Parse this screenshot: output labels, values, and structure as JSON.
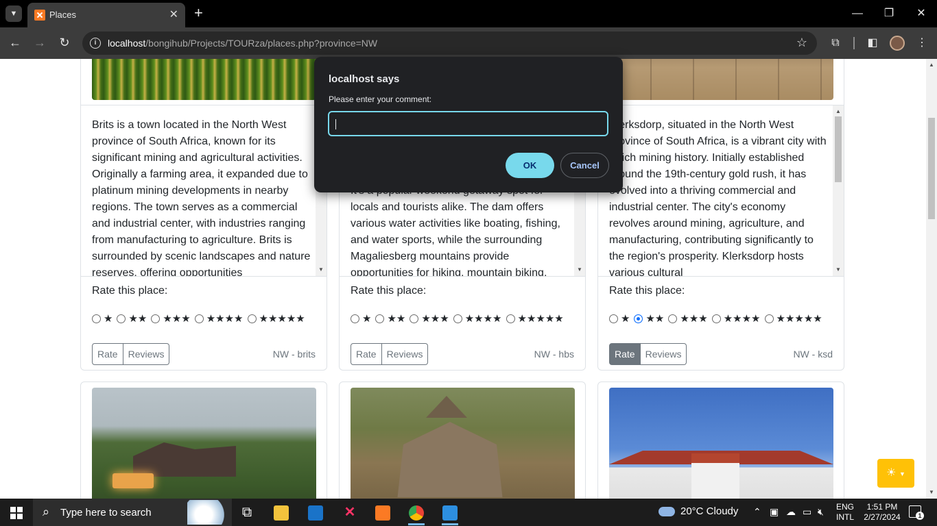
{
  "browser": {
    "tab_title": "Places",
    "url_host": "localhost",
    "url_path": "/bongihub/Projects/TOURza/places.php?province=NW"
  },
  "dialog": {
    "title": "localhost says",
    "message": "Please enter your comment:",
    "input_value": "",
    "ok_label": "OK",
    "cancel_label": "Cancel"
  },
  "cards": [
    {
      "description": "Brits is a town located in the North West province of South Africa, known for its significant mining and agricultural activities. Originally a farming area, it expanded due to platinum mining developments in nearby regions. The town serves as a commercial and industrial center, with industries ranging from manufacturing to agriculture. Brits is surrounded by scenic landscapes and nature reserves, offering opportunities",
      "rate_label": "Rate this place:",
      "rating_options": [
        "★",
        "★★",
        "★★★",
        "★★★★",
        "★★★★★"
      ],
      "selected_rating": 0,
      "rate_button": "Rate",
      "reviews_button": "Reviews",
      "tag": "NW - brits"
    },
    {
      "description": "It's a popular weekend getaway spot for locals and tourists alike. The dam offers various water activities like boating, fishing, and water sports, while the surrounding Magaliesberg mountains provide opportunities for hiking, mountain biking,",
      "rate_label": "Rate this place:",
      "rating_options": [
        "★",
        "★★",
        "★★★",
        "★★★★",
        "★★★★★"
      ],
      "selected_rating": 0,
      "rate_button": "Rate",
      "reviews_button": "Reviews",
      "tag": "NW - hbs"
    },
    {
      "description": "Klerksdorp, situated in the North West province of South Africa, is a vibrant city with a rich mining history. Initially established around the 19th-century gold rush, it has evolved into a thriving commercial and industrial center. The city's economy revolves around mining, agriculture, and manufacturing, contributing significantly to the region's prosperity. Klerksdorp hosts various cultural",
      "rate_label": "Rate this place:",
      "rating_options": [
        "★",
        "★★",
        "★★★",
        "★★★★",
        "★★★★★"
      ],
      "selected_rating": 2,
      "rate_button": "Rate",
      "reviews_button": "Reviews",
      "tag": "NW - ksd"
    }
  ],
  "taskbar": {
    "search_placeholder": "Type here to search",
    "weather": "20°C  Cloudy",
    "lang_line1": "ENG",
    "lang_line2": "INTL",
    "time": "1:51 PM",
    "date": "2/27/2024",
    "notification_count": "1"
  },
  "colors": {
    "dialog_accent": "#78d9ec",
    "theme_button": "#ffc107",
    "button_secondary": "#6c757d"
  }
}
